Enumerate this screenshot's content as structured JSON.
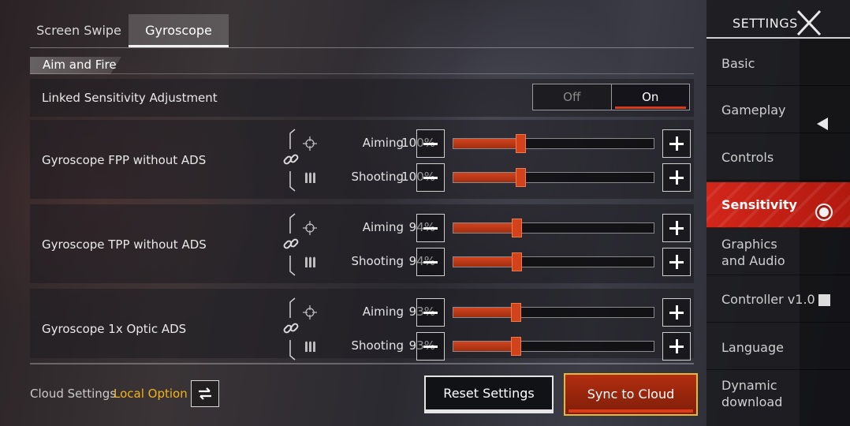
{
  "tabs": [
    {
      "label": "Screen Swipe",
      "active": false
    },
    {
      "label": "Gyroscope",
      "active": true
    }
  ],
  "section": {
    "title": "Aim and Fire"
  },
  "linked": {
    "label": "Linked Sensitivity Adjustment",
    "off_label": "Off",
    "on_label": "On",
    "value": "On"
  },
  "rows": [
    {
      "label": "Gyroscope FPP without ADS",
      "aiming": {
        "label": "Aiming",
        "value": "100%",
        "percent": 100
      },
      "shooting": {
        "label": "Shooting",
        "value": "100%",
        "percent": 100
      }
    },
    {
      "label": "Gyroscope TPP without ADS",
      "aiming": {
        "label": "Aiming",
        "value": "94%",
        "percent": 94
      },
      "shooting": {
        "label": "Shooting",
        "value": "94%",
        "percent": 94
      }
    },
    {
      "label": "Gyroscope 1x Optic ADS",
      "aiming": {
        "label": "Aiming",
        "value": "93%",
        "percent": 93
      },
      "shooting": {
        "label": "Shooting",
        "value": "93%",
        "percent": 93
      }
    }
  ],
  "slider_max_percent": 300,
  "footer": {
    "cloud_label": "Cloud Settings",
    "local_option": "Local Option",
    "reset_label": "Reset Settings",
    "sync_label": "Sync to Cloud"
  },
  "sidebar": {
    "title": "SETTINGS",
    "items": [
      {
        "label": "Basic",
        "indicator": ""
      },
      {
        "label": "Gameplay",
        "indicator": "triangle"
      },
      {
        "label": "Controls",
        "indicator": ""
      },
      {
        "label": "Sensitivity",
        "indicator": "radio",
        "active": true
      },
      {
        "label": "Graphics and Audio",
        "indicator": ""
      },
      {
        "label": "Controller v1.0",
        "indicator": "square"
      },
      {
        "label": "Language",
        "indicator": ""
      },
      {
        "label": "Dynamic download",
        "indicator": ""
      }
    ]
  },
  "colors": {
    "accent": "#d2431c",
    "active_menu": "#d2261a",
    "local_option": "#f2b21b",
    "sync_border": "#e5b83a"
  },
  "icons": {
    "aiming": "crosshair-icon",
    "shooting": "bullets-icon",
    "link": "link-icon",
    "swap": "swap-arrows-icon",
    "close": "close-x-icon"
  }
}
